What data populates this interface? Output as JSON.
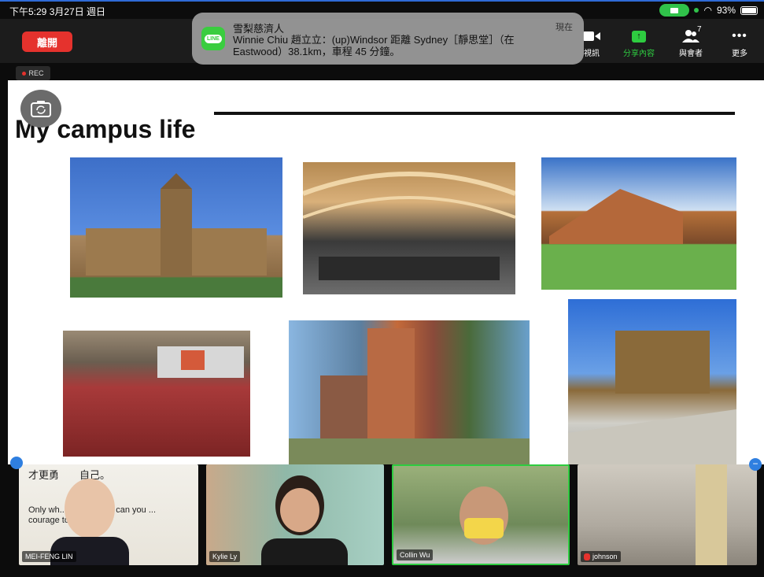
{
  "status_bar": {
    "time": "下午5:29  3月27日 週日",
    "battery": "93%"
  },
  "toolbar": {
    "leave_label": "離開",
    "video_label": "視訊",
    "share_label": "分享內容",
    "participants_label": "與會者",
    "participants_count": "7",
    "more_label": "更多"
  },
  "notification": {
    "app_icon": "LINE",
    "title": "雪梨慈濟人",
    "body": "Winnie Chiu 趙立立：(up)Windsor 距離 Sydney［靜思堂］（在 Eastwood）38.1km，車程 45 分鐘。",
    "time": "現在"
  },
  "recording": {
    "label": "REC"
  },
  "slide": {
    "title": "My campus life"
  },
  "participants": [
    {
      "name": "MEI-FENG LIN",
      "quote_line1": "才更勇",
      "quote_line2": "自己。",
      "quote_en": "Only wh... ect yourself can you ... courage to humble..."
    },
    {
      "name": "Kylie Ly"
    },
    {
      "name": "Collin Wu"
    },
    {
      "name": "johnson"
    }
  ],
  "colors": {
    "leave": "#e5322d",
    "share_active": "#2ecc40",
    "accent": "#2f6bd6"
  }
}
